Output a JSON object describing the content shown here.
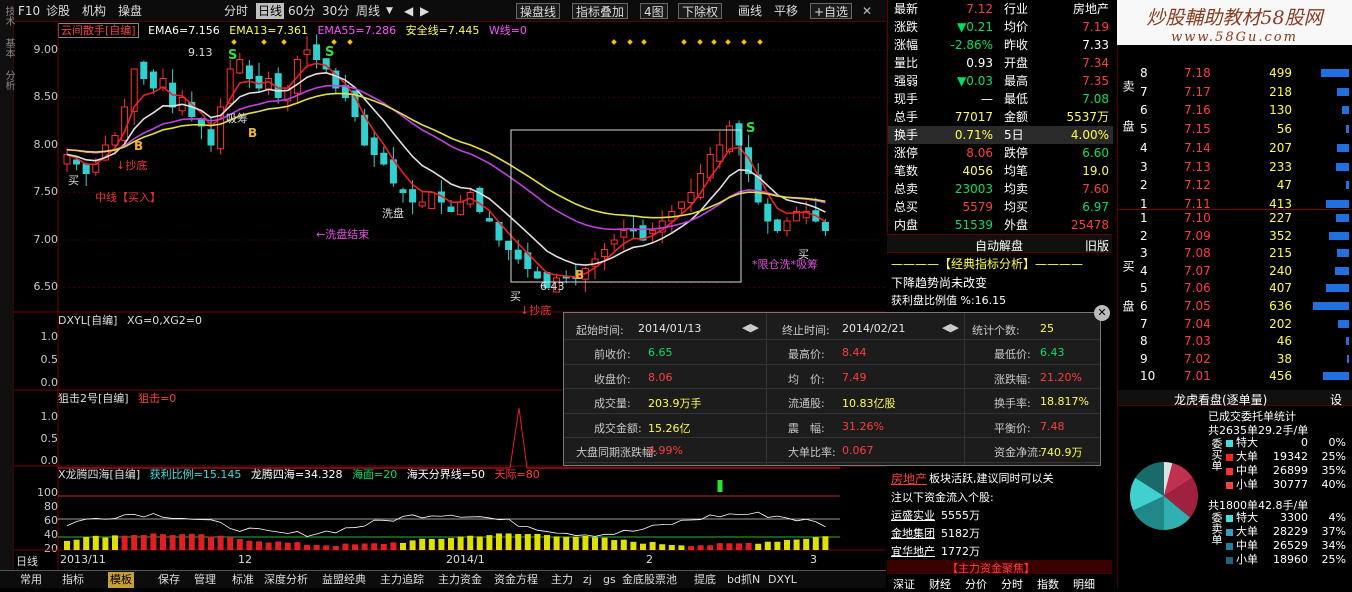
{
  "topbar": {
    "items": [
      "F10",
      "诊股",
      "机构",
      "操盘"
    ],
    "periods": [
      "分时",
      "日线",
      "60分",
      "30分",
      "周线"
    ],
    "selected_period": "日线",
    "right_buttons": [
      "操盘线",
      "指标叠加",
      "4图",
      "下除权",
      "画线",
      "平移",
      "+自选"
    ]
  },
  "legend": {
    "name": "云间散手[自编]",
    "ema6": "EMA6=7.156",
    "ema13": "EMA13=7.361",
    "ema55": "EMA55=7.286",
    "safe": "安全线=7.445",
    "w": "W线=0"
  },
  "main_axis": [
    "9.00",
    "8.50",
    "8.00",
    "7.50",
    "7.00",
    "6.50"
  ],
  "annotations": {
    "high": "9.13",
    "low": "6.43",
    "buy1": "买",
    "buy2": "买",
    "bottom": "↓抄底",
    "buy_mid": "中线【买入】",
    "wash_end": "←洗盘结束",
    "washpan": "洗盘",
    "wash2": "吸筹",
    "right_mark": "*限仓洗*吸筹",
    "buy3": "买",
    "bottom2": "↓抄底",
    "s_marks": [
      "S",
      "S",
      "S"
    ],
    "b_marks": [
      "B",
      "B",
      "B"
    ]
  },
  "panel2": {
    "name": "DXYL[自编]",
    "values": "XG=0,XG2=0",
    "axis": [
      "1.0",
      "0.5",
      "0.0"
    ]
  },
  "panel3": {
    "name": "狙击2号[自编]",
    "values": "狙击=0",
    "axis": [
      "1.0",
      "0.5",
      "0.0"
    ]
  },
  "panel4": {
    "name": "X龙腾四海[自编]",
    "v1": "获利比例=15.145",
    "v2": "龙腾四海=34.328",
    "v3": "海面=20",
    "v4": "海天分界线=50",
    "v5": "天际=80",
    "axis": [
      "100",
      "80",
      "60",
      "40",
      "20"
    ]
  },
  "date_axis": {
    "label": "日线",
    "start": "2013/11",
    "m12": "12",
    "y2014": "2014/1",
    "m2": "2",
    "m3": "3"
  },
  "bottombar": [
    "常用",
    "指标",
    "模板",
    "保存",
    "管理",
    "标准",
    "深度分析",
    "益盟经典",
    "主力追踪",
    "主力资金",
    "资金方程",
    "主力",
    "zj",
    "gs",
    "金底股票池",
    "提底",
    "bd抓N",
    "DXYL"
  ],
  "bottombar_selected": "模板",
  "popup": {
    "start_label": "起始时间:",
    "start": "2014/01/13",
    "end_label": "终止时间:",
    "end": "2014/02/21",
    "count_label": "统计个数:",
    "count": "25",
    "rows": [
      [
        {
          "l": "前收价:",
          "v": "6.65",
          "c": "green"
        },
        {
          "l": "最高价:",
          "v": "8.44",
          "c": "red"
        },
        {
          "l": "最低价:",
          "v": "6.43",
          "c": "green"
        }
      ],
      [
        {
          "l": "收盘价:",
          "v": "8.06",
          "c": "red"
        },
        {
          "l": "均　价:",
          "v": "7.49",
          "c": "red"
        },
        {
          "l": "涨跌幅:",
          "v": "21.20%",
          "c": "red"
        }
      ],
      [
        {
          "l": "成交量:",
          "v": "203.9万手",
          "c": "yellow"
        },
        {
          "l": "流通股:",
          "v": "10.83亿股",
          "c": "yellow"
        },
        {
          "l": "换手率:",
          "v": "18.817%",
          "c": "yellow"
        }
      ],
      [
        {
          "l": "成交金额:",
          "v": "15.26亿",
          "c": "yellow"
        },
        {
          "l": "震　幅:",
          "v": "31.26%",
          "c": "red"
        },
        {
          "l": "平衡价:",
          "v": "7.48",
          "c": "red"
        }
      ],
      [
        {
          "l": "大盘同期涨跌幅:",
          "v": "4.99%",
          "c": "red"
        },
        {
          "l": "大单比率:",
          "v": "0.067",
          "c": "red"
        },
        {
          "l": "资金净流:",
          "v": "740.9万",
          "c": "yellow"
        }
      ]
    ]
  },
  "quote": [
    [
      "最新",
      "7.12",
      "red",
      "行业",
      "房地产",
      "white"
    ],
    [
      "涨跌",
      "▼0.21",
      "green",
      "均价",
      "7.19",
      "red"
    ],
    [
      "涨幅",
      "-2.86%",
      "green",
      "昨收",
      "7.33",
      "white"
    ],
    [
      "量比",
      "0.93",
      "white",
      "开盘",
      "7.34",
      "red"
    ],
    [
      "强弱",
      "▼0.03",
      "green",
      "最高",
      "7.35",
      "red"
    ],
    [
      "现手",
      "—",
      "white",
      "最低",
      "7.08",
      "green"
    ],
    [
      "总手",
      "77017",
      "yellow",
      "金额",
      "5537万",
      "yellow"
    ],
    [
      "换手",
      "0.71%",
      "yellow",
      "5日",
      "4.00%",
      "yellow"
    ],
    [
      "涨停",
      "8.06",
      "red",
      "跌停",
      "6.60",
      "green"
    ],
    [
      "笔数",
      "4056",
      "yellow",
      "均笔",
      "19.0",
      "yellow"
    ],
    [
      "总卖",
      "23003",
      "green",
      "均卖",
      "7.60",
      "red"
    ],
    [
      "总买",
      "5579",
      "red",
      "均买",
      "6.97",
      "green"
    ],
    [
      "内盘",
      "51539",
      "green",
      "外盘",
      "25478",
      "red"
    ]
  ],
  "ai": {
    "title": "自动解盘",
    "tab": "旧版",
    "subtitle": "————【经典指标分析】————",
    "line1": "下降趋势尚未改变",
    "line2": "获利盘比例值 %:16.15"
  },
  "news": {
    "tag": "【主力资金聚焦】",
    "line0a": "房地产",
    "line0b": "板块活跃,建议同时可以关",
    "line1": "注以下资金流入个股:",
    "stocks": [
      [
        "运盛实业",
        "5555万"
      ],
      [
        "金地集团",
        "5182万"
      ],
      [
        "宜华地产",
        "1772万"
      ]
    ],
    "tabs": [
      "深证",
      "财经",
      "分价",
      "分时",
      "指数",
      "明细"
    ]
  },
  "watermark": {
    "line1": "炒股輔助教材58股网",
    "line2": "www.58Gu.com"
  },
  "book": {
    "sell_label": "卖盘",
    "buy_label": "买盘",
    "sells": [
      [
        "8",
        "7.18",
        "499"
      ],
      [
        "7",
        "7.17",
        "218"
      ],
      [
        "6",
        "7.16",
        "130"
      ],
      [
        "5",
        "7.15",
        "56"
      ],
      [
        "4",
        "7.14",
        "207"
      ],
      [
        "3",
        "7.13",
        "233"
      ],
      [
        "2",
        "7.12",
        "47"
      ],
      [
        "1",
        "7.11",
        "413"
      ]
    ],
    "buys": [
      [
        "1",
        "7.10",
        "227"
      ],
      [
        "2",
        "7.09",
        "352"
      ],
      [
        "3",
        "7.08",
        "215"
      ],
      [
        "4",
        "7.07",
        "240"
      ],
      [
        "5",
        "7.06",
        "407"
      ],
      [
        "6",
        "7.05",
        "636"
      ],
      [
        "7",
        "7.04",
        "202"
      ],
      [
        "8",
        "7.03",
        "46"
      ],
      [
        "9",
        "7.02",
        "38"
      ],
      [
        "10",
        "7.01",
        "456"
      ]
    ]
  },
  "lhk": {
    "title": "龙虎看盘(逐单量)",
    "tab": "设",
    "subtitle": "已成交委托单统计",
    "buy_total": "共2635单29.2手/单",
    "buy_side": "委买单",
    "buy_rows": [
      [
        "特大",
        "0",
        "0%"
      ],
      [
        "大单",
        "19342",
        "25%"
      ],
      [
        "中单",
        "26899",
        "35%"
      ],
      [
        "小单",
        "30777",
        "40%"
      ]
    ],
    "sell_total": "共1800单42.8手/单",
    "sell_side": "委卖单",
    "sell_rows": [
      [
        "特大",
        "3300",
        "4%"
      ],
      [
        "大单",
        "28229",
        "37%"
      ],
      [
        "中单",
        "26529",
        "34%"
      ],
      [
        "小单",
        "18960",
        "25%"
      ]
    ]
  }
}
